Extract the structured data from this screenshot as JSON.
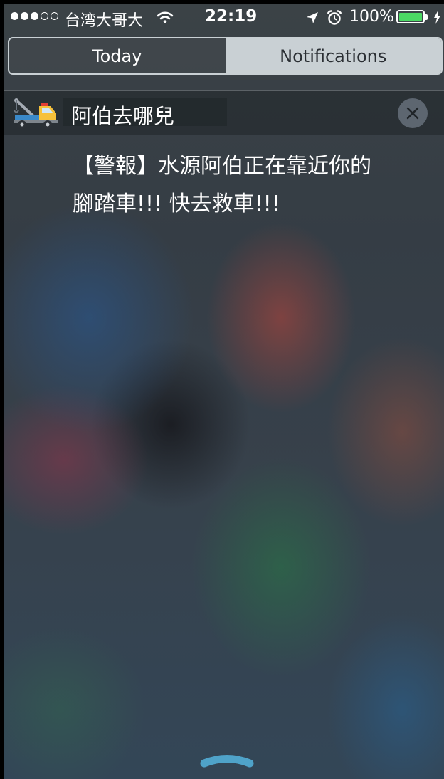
{
  "status_bar": {
    "signal_filled": 3,
    "signal_total": 5,
    "carrier": "台湾大哥大",
    "time": "22:19",
    "battery_percent": "100%",
    "battery_level": 1.0,
    "icons": [
      "signal-dots",
      "wifi-icon",
      "location-arrow-icon",
      "alarm-clock-icon",
      "battery-icon",
      "charging-bolt-icon"
    ],
    "battery_color": "#4cd964"
  },
  "segmented_control": {
    "tabs": [
      {
        "label": "Today",
        "selected": false
      },
      {
        "label": "Notifications",
        "selected": true
      }
    ]
  },
  "notification": {
    "app_name": "阿伯去哪兒",
    "app_icon": "tow-truck-icon",
    "line1": "【警報】水源阿伯正在靠近你的",
    "line2": "腳踏車!!! 快去救車!!!",
    "close_icon": "close-icon"
  },
  "footer": {
    "grabber_icon": "chevron-up-grabber-icon"
  }
}
